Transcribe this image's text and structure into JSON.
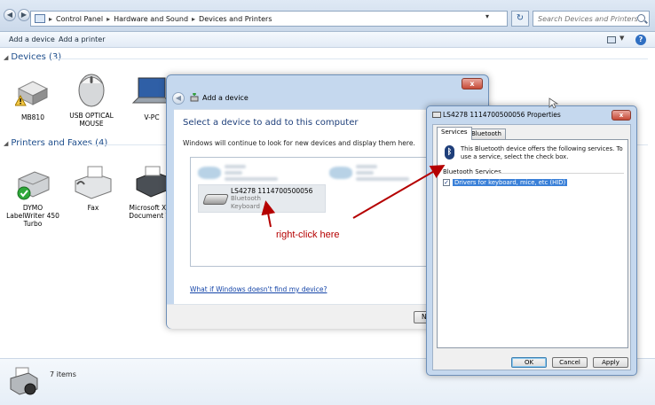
{
  "address": {
    "crumbs": [
      "Control Panel",
      "Hardware and Sound",
      "Devices and Printers"
    ],
    "separator": "▸",
    "search_placeholder": "Search Devices and Printers"
  },
  "toolbar": {
    "add_device": "Add a device",
    "add_printer": "Add a printer",
    "help": "?"
  },
  "devices_section": {
    "title": "Devices (3)",
    "items": [
      {
        "label": "MB810",
        "icon": "hard-drive-icon"
      },
      {
        "label": "USB OPTICAL MOUSE",
        "icon": "mouse-icon"
      },
      {
        "label": "V-PC",
        "icon": "laptop-icon"
      }
    ]
  },
  "printers_section": {
    "title": "Printers and Faxes (4)",
    "items": [
      {
        "label": "DYMO LabelWriter 450 Turbo",
        "icon": "label-printer-icon"
      },
      {
        "label": "Fax",
        "icon": "fax-icon"
      },
      {
        "label": "Microsoft XPS Document Wr",
        "icon": "printer-icon"
      }
    ]
  },
  "status": {
    "items_count": "7 items"
  },
  "add_device_dialog": {
    "title": "Add a device",
    "heading": "Select a device to add to this computer",
    "subtitle": "Windows will continue to look for new devices and display them here.",
    "selected_device": {
      "name": "LS4278 1114700500056",
      "protocol": "Bluetooth",
      "type": "Keyboard"
    },
    "help_link": "What if Windows doesn't find my device?",
    "next_button": "Next",
    "close": "x"
  },
  "properties_dialog": {
    "title": "LS4278 1114700500056     Properties",
    "tabs": [
      {
        "label": "Services",
        "active": true
      },
      {
        "label": "Bluetooth",
        "active": false
      }
    ],
    "description": "This Bluetooth device offers the following services. To use a service, select the check box.",
    "services_header": "Bluetooth Services",
    "services": [
      {
        "label": "Drivers for keyboard, mice, etc (HID)",
        "checked": true
      }
    ],
    "buttons": {
      "ok": "OK",
      "cancel": "Cancel",
      "apply": "Apply"
    },
    "close": "x"
  },
  "annotation": {
    "text": "right-click here",
    "color": "#b50000"
  },
  "colors": {
    "link": "#1545a8",
    "section_header": "#1e4e8c",
    "selection": "#3a80d8",
    "dialog_frame": "#c5d8ee"
  }
}
